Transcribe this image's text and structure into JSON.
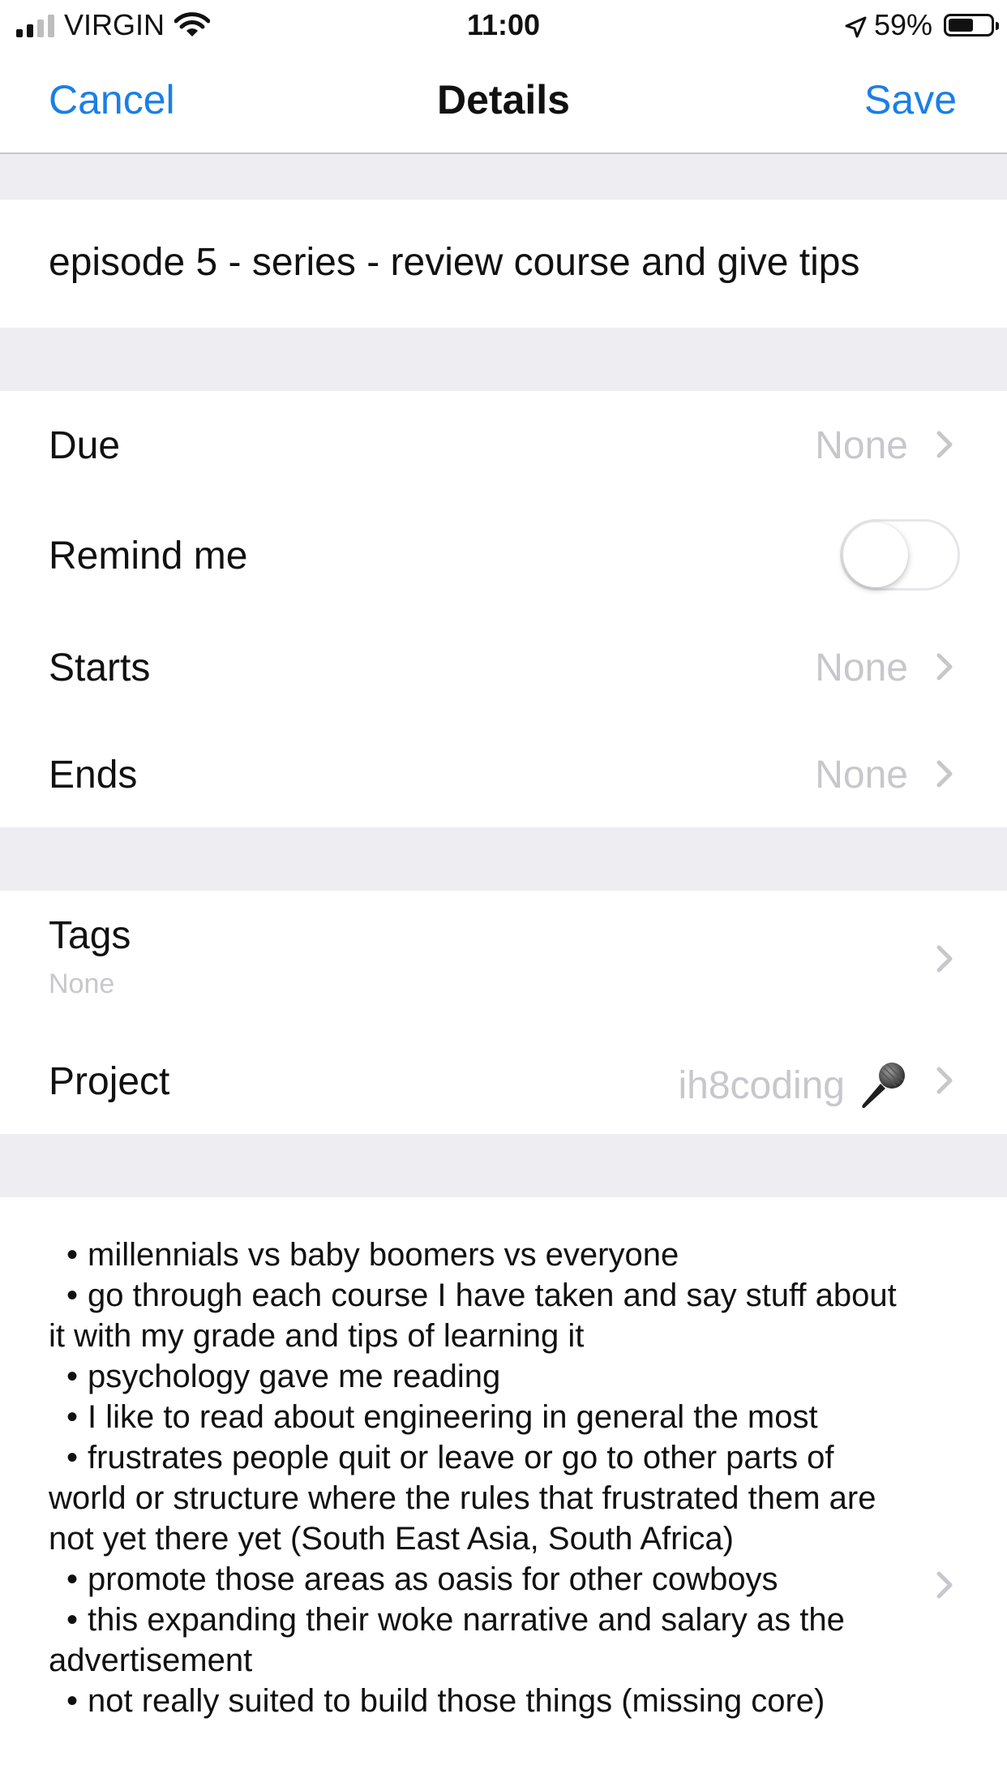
{
  "status_bar": {
    "carrier": "VIRGIN",
    "time": "11:00",
    "battery_percent": "59%",
    "battery_level": 0.59
  },
  "nav": {
    "cancel_label": "Cancel",
    "title": "Details",
    "save_label": "Save"
  },
  "task": {
    "title": "episode 5 - series - review course and give tips"
  },
  "rows": {
    "due": {
      "label": "Due",
      "value": "None"
    },
    "remind": {
      "label": "Remind me",
      "enabled": false
    },
    "starts": {
      "label": "Starts",
      "value": "None"
    },
    "ends": {
      "label": "Ends",
      "value": "None"
    },
    "tags": {
      "label": "Tags",
      "value": "None"
    },
    "project": {
      "label": "Project",
      "value": "ih8coding",
      "icon": "microphone-icon"
    }
  },
  "notes": {
    "lines": [
      {
        "bullet": "•",
        "text": "millennials vs baby boomers vs everyone"
      },
      {
        "bullet": "•",
        "text": "go through each course I have taken and say stuff about it with my grade and tips of learning it"
      },
      {
        "bullet": "•",
        "text": "psychology gave me reading"
      },
      {
        "bullet": "•",
        "text": "I like to read about engineering in general the most"
      },
      {
        "bullet": "•",
        "text": "frustrates people quit or leave or go to other parts of world or structure where the rules that frustrated them are not yet there yet (South East Asia, South Africa)"
      },
      {
        "bullet": "•",
        "text": "promote those areas as oasis for other cowboys"
      },
      {
        "bullet": "•",
        "text": "this expanding their woke narrative and salary as the advertisement"
      },
      {
        "bullet": "•",
        "text": "not really suited to build those things (missing core)"
      }
    ]
  },
  "colors": {
    "accent": "#1a7fe6",
    "placeholder": "#c7c7cc",
    "group_background": "#eeeef2"
  }
}
